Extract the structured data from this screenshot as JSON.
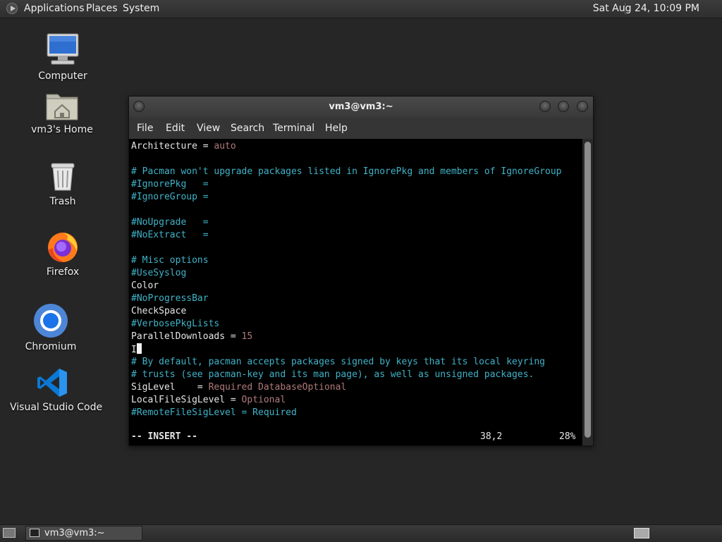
{
  "top_panel": {
    "menus": [
      "Applications",
      "Places",
      "System"
    ],
    "clock": "Sat Aug 24, 10:09 PM"
  },
  "desktop": {
    "icons": [
      {
        "label": "Computer",
        "icon": "computer-icon"
      },
      {
        "label": "vm3's Home",
        "icon": "home-folder-icon"
      },
      {
        "label": "Trash",
        "icon": "trash-icon"
      },
      {
        "label": "Firefox",
        "icon": "firefox-icon"
      },
      {
        "label": "Chromium",
        "icon": "chromium-icon"
      },
      {
        "label": "Visual Studio Code",
        "icon": "vscode-icon"
      }
    ]
  },
  "terminal": {
    "title": "vm3@vm3:~",
    "menu": [
      "File",
      "Edit",
      "View",
      "Search",
      "Terminal",
      "Help"
    ],
    "lines": [
      [
        {
          "t": "Architecture = ",
          "c": "plain"
        },
        {
          "t": "auto",
          "c": "value"
        }
      ],
      [],
      [
        {
          "t": "# Pacman won't upgrade packages listed in IgnorePkg and members of IgnoreGroup",
          "c": "comment"
        }
      ],
      [
        {
          "t": "#IgnorePkg   =",
          "c": "comment"
        }
      ],
      [
        {
          "t": "#IgnoreGroup =",
          "c": "comment"
        }
      ],
      [],
      [
        {
          "t": "#NoUpgrade   =",
          "c": "comment"
        }
      ],
      [
        {
          "t": "#NoExtract   =",
          "c": "comment"
        }
      ],
      [],
      [
        {
          "t": "# Misc options",
          "c": "comment"
        }
      ],
      [
        {
          "t": "#UseSyslog",
          "c": "comment"
        }
      ],
      [
        {
          "t": "Color",
          "c": "plain"
        }
      ],
      [
        {
          "t": "#NoProgressBar",
          "c": "comment"
        }
      ],
      [
        {
          "t": "CheckSpace",
          "c": "plain"
        }
      ],
      [
        {
          "t": "#VerbosePkgLists",
          "c": "comment"
        }
      ],
      [
        {
          "t": "ParallelDownloads = ",
          "c": "plain"
        },
        {
          "t": "15",
          "c": "num"
        }
      ],
      [
        {
          "t": "I",
          "c": "plain"
        },
        {
          "t": "",
          "c": "cursor"
        }
      ],
      [
        {
          "t": "# By default, pacman accepts packages signed by keys that its local keyring",
          "c": "comment"
        }
      ],
      [
        {
          "t": "# trusts (see pacman-key and its man page), as well as unsigned packages.",
          "c": "comment"
        }
      ],
      [
        {
          "t": "SigLevel    = ",
          "c": "plain"
        },
        {
          "t": "Required DatabaseOptional",
          "c": "value"
        }
      ],
      [
        {
          "t": "LocalFileSigLevel = ",
          "c": "plain"
        },
        {
          "t": "Optional",
          "c": "value"
        }
      ],
      [
        {
          "t": "#RemoteFileSigLevel = Required",
          "c": "comment"
        }
      ]
    ],
    "status": {
      "mode": "-- INSERT --",
      "position": "38,2",
      "percent": "28%"
    }
  },
  "taskbar": {
    "window_label": "vm3@vm3:~"
  }
}
